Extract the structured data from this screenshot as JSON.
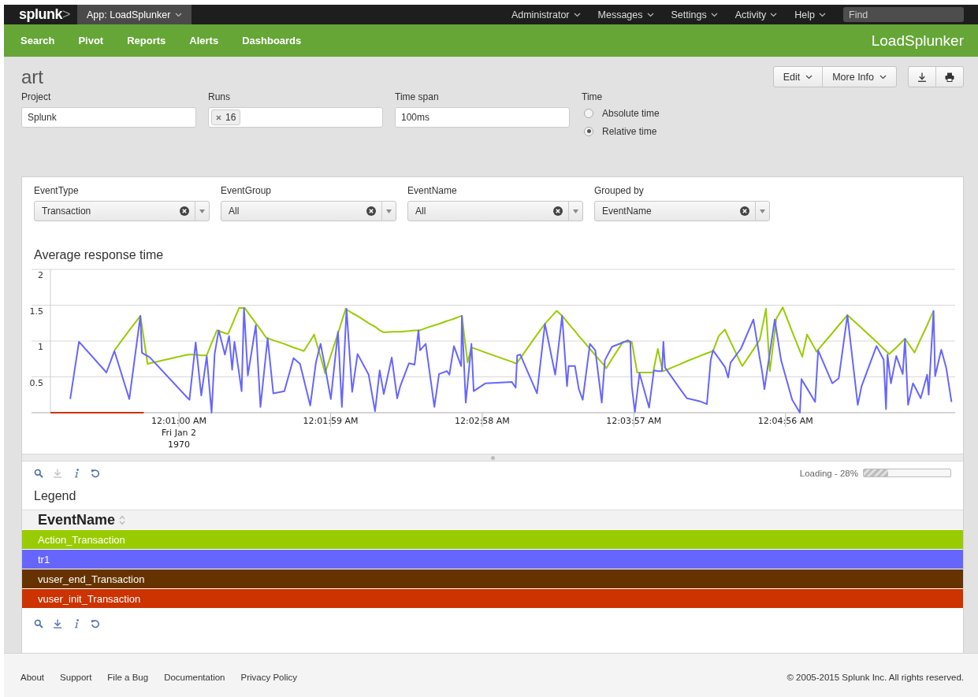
{
  "top_bar": {
    "logo": {
      "word": "splunk",
      "mark": ">"
    },
    "app_menu": "App: LoadSplunker",
    "menus": [
      "Administrator",
      "Messages",
      "Settings",
      "Activity",
      "Help"
    ],
    "search": {
      "placeholder": "Find"
    }
  },
  "nav": {
    "items": [
      "Search",
      "Pivot",
      "Reports",
      "Alerts",
      "Dashboards"
    ],
    "app_name": "LoadSplunker"
  },
  "page": {
    "title": "art",
    "buttons": [
      "Edit",
      "More Info"
    ],
    "icon_buttons": [
      {
        "kind": "download"
      },
      {
        "kind": "print"
      }
    ]
  },
  "inputs": {
    "project": {
      "label": "Project",
      "value": "Splunk"
    },
    "runs": {
      "label": "Runs",
      "tokens": [
        "16"
      ]
    },
    "time_span": {
      "label": "Time span",
      "value": "100ms"
    },
    "time": {
      "label": "Time",
      "options": [
        {
          "label": "Absolute time",
          "selected": false
        },
        {
          "label": "Relative time",
          "selected": true
        }
      ]
    }
  },
  "filters": [
    {
      "label": "EventType",
      "value": "Transaction"
    },
    {
      "label": "EventGroup",
      "value": "All"
    },
    {
      "label": "EventName",
      "value": "All"
    },
    {
      "label": "Grouped by",
      "value": "EventName"
    }
  ],
  "chart_panel": {
    "date_lines": [
      "Fri Jan 2",
      "1970"
    ],
    "chart_data": {
      "type": "line",
      "title": "Average response time",
      "grid": true,
      "xlim": [
        10,
        362
      ],
      "ylim": [
        0,
        2
      ],
      "yticks": [
        0.5,
        1,
        1.5,
        2
      ],
      "xticks": [
        {
          "value": 60,
          "label": "12:01:00 AM"
        },
        {
          "value": 119,
          "label": "12:01:59 AM"
        },
        {
          "value": 178,
          "label": "12:02:58 AM"
        },
        {
          "value": 237,
          "label": "12:03:57 AM"
        },
        {
          "value": 296,
          "label": "12:04:56 AM"
        }
      ],
      "x": [
        10,
        17.7,
        21.1,
        31.8,
        34.9,
        40.7,
        45.0,
        45.6,
        46.3,
        47.8,
        48.7,
        63.5,
        64.1,
        66.5,
        68.7,
        70.8,
        72.7,
        73.9,
        74.8,
        75.5,
        77.9,
        79.1,
        79.5,
        80.7,
        81.6,
        83.4,
        84.4,
        85.3,
        85.6,
        86.8,
        89.9,
        91.7,
        93.9,
        94.5,
        96.7,
        101.0,
        104.6,
        107.1,
        108.6,
        111.1,
        112.6,
        113.3,
        115.1,
        116.9,
        117.2,
        119.1,
        121.9,
        123.4,
        124.9,
        125.2,
        127.4,
        129.5,
        133.8,
        136.3,
        138.1,
        139.7,
        142.8,
        144.9,
        146.1,
        149.5,
        151.7,
        153.2,
        153.8,
        156.0,
        159.4,
        161.2,
        164.3,
        165.2,
        167.0,
        169.8,
        170.1,
        171.6,
        172.3,
        173.8,
        174.7,
        179.3,
        189.5,
        191.0,
        191.3,
        191.6,
        192.8,
        199.3,
        202.4,
        206.4,
        207.0,
        209.1,
        211.0,
        211.6,
        214.1,
        215.6,
        217.1,
        219.9,
        222.0,
        224.5,
        225.7,
        226.3,
        228.5,
        232.8,
        234.6,
        235.6,
        236.2,
        237.4,
        238.3,
        239.2,
        242.9,
        244.5,
        244.8,
        246.3,
        247.9,
        248.2,
        248.5,
        249.1,
        255.2,
        257.7,
        262.6,
        265.4,
        266.9,
        267.8,
        270.0,
        272.4,
        273.7,
        274.6,
        278.6,
        279.2,
        283.5,
        286.0,
        286.9,
        287.8,
        288.4,
        289.9,
        291.8,
        292.4,
        294.3,
        294.9,
        298.6,
        301.6,
        302.2,
        302.5,
        304.4,
        307.5,
        308.1,
        308.7,
        314.2,
        316.7,
        320.1,
        324.1,
        325.6,
        331.4,
        334.2,
        335.1,
        335.7,
        336.4,
        337.0,
        339.1,
        341.6,
        342.5,
        343.7,
        345.6,
        346.2,
        348.6,
        351.1,
        351.7,
        353.6,
        354.2,
        356.6,
        358.5,
        360.6
      ],
      "series": [
        {
          "color": "#99cc00",
          "values": [
            null,
            null,
            null,
            null,
            0.87,
            1.15,
            1.35,
            1.21,
            1.04,
            0.68,
            0.69,
            0.81,
            0.81,
            0.81,
            0.8,
            0.8,
            0.97,
            1.07,
            1.15,
            1.14,
            1.11,
            1.1,
            1.13,
            1.23,
            1.31,
            1.46,
            1.46,
            1.46,
            1.46,
            1.4,
            1.25,
            1.16,
            1.05,
            1.04,
            1.01,
            0.96,
            0.91,
            0.88,
            0.86,
            1.0,
            1.09,
            1.0,
            0.78,
            0.55,
            0.59,
            0.8,
            1.11,
            1.28,
            1.45,
            1.44,
            1.39,
            1.35,
            1.25,
            1.2,
            1.15,
            1.12,
            1.13,
            1.13,
            1.13,
            1.14,
            1.15,
            1.15,
            1.15,
            1.18,
            1.22,
            1.24,
            1.28,
            1.29,
            1.31,
            1.35,
            1.35,
            0.91,
            0.7,
            0.91,
            0.9,
            0.84,
            0.71,
            0.69,
            0.69,
            0.7,
            0.76,
            1.09,
            1.24,
            1.4,
            1.42,
            1.35,
            1.27,
            1.24,
            1.14,
            1.07,
            1.01,
            0.89,
            0.8,
            0.7,
            0.65,
            0.62,
            0.75,
            0.99,
            0.99,
            0.99,
            0.99,
            0.74,
            0.56,
            0.56,
            0.56,
            0.56,
            0.62,
            0.89,
            0.63,
            0.58,
            0.58,
            0.59,
            0.68,
            0.72,
            0.79,
            0.83,
            0.85,
            0.86,
            1.07,
            1.16,
            1.06,
            0.99,
            0.69,
            0.65,
            0.88,
            1.02,
            1.18,
            1.34,
            1.45,
            0.58,
            1.13,
            1.31,
            1.43,
            1.47,
            1.13,
            0.86,
            0.81,
            0.78,
            1.09,
            0.89,
            0.85,
            0.88,
            1.11,
            1.22,
            1.36,
            1.23,
            1.18,
            0.99,
            0.89,
            0.86,
            0.84,
            0.82,
            0.84,
            0.91,
            1.0,
            1.03,
            0.97,
            0.87,
            0.84,
            1.03,
            1.22,
            1.27,
            1.42,
            null,
            null,
            null,
            null
          ]
        },
        {
          "color": "#6666ff",
          "values": [
            null,
            0.19,
            0.99,
            0.56,
            0.86,
            0.19,
            1.35,
            0.84,
            0.82,
            0.79,
            0.77,
            0.2,
            0.18,
            0.98,
            0.24,
            0.79,
            0,
            0.82,
            1.01,
            1.15,
            0.81,
            1.01,
            1.07,
            0.6,
            0.99,
            0.55,
            0.3,
            1.46,
            1.27,
            0.52,
            1.22,
            0.08,
            0.83,
            1.04,
            0.27,
            0.3,
            0.76,
            0.68,
            0.46,
            0.1,
            0.51,
            0.7,
            0.96,
            0.63,
            0.57,
            0.19,
            1.13,
            0.08,
            1.22,
            1.45,
            0.29,
            0.82,
            0.53,
            0.02,
            0.59,
            0.26,
            0.77,
            0.2,
            0.37,
            0.69,
            0.67,
            1.15,
            0.87,
            0.96,
            0.08,
            0.54,
            0.58,
            0.53,
            0.93,
            0.65,
            1.35,
            0.14,
            0.4,
            0.96,
            0.3,
            0.41,
            0.43,
            0.35,
            0.58,
            0.8,
            0.81,
            0.27,
            1.24,
            0.53,
            0.71,
            1.35,
            0.37,
            0.65,
            0.65,
            0.33,
            0.18,
            0.96,
            0.87,
            0.14,
            0.73,
            0.77,
            0.92,
            0.98,
            1.01,
            0.99,
            0.37,
            0.01,
            0.28,
            0.55,
            0.07,
            0.51,
            0.59,
            0.58,
            0.58,
            0.79,
            0.99,
            0.63,
            0.32,
            0.2,
            0.16,
            0.12,
            0.73,
            0.87,
            0.76,
            0.64,
            0.49,
            0.7,
            0.89,
            0.94,
            1.3,
            0.76,
            0.57,
            0.33,
            0.48,
            0.84,
            1.3,
            1.16,
            0.73,
            0.65,
            0.18,
            0,
            0.47,
            0.45,
            0.34,
            0.15,
            0.51,
            0.87,
            0.41,
            0.48,
            1.36,
            0.11,
            0.37,
            0.93,
            0.74,
            0.05,
            0.81,
            0.59,
            0.41,
            0.79,
            0.54,
            1.03,
            0.11,
            0.41,
            0.37,
            0.2,
            0.53,
            0.25,
            1.42,
            0.51,
            0.88,
            0.63,
            0.15
          ]
        },
        {
          "color": "#cc3300",
          "values": [
            0,
            0,
            0,
            0,
            0,
            0,
            0,
            0,
            0,
            null,
            null,
            null,
            null,
            null,
            null,
            null,
            null,
            null,
            null,
            null,
            null,
            null,
            null,
            null,
            null,
            null,
            null,
            null,
            null,
            null,
            null,
            null,
            null,
            null,
            null,
            null,
            null,
            null,
            null,
            null,
            null,
            null,
            null,
            null,
            null,
            null,
            null,
            null,
            null,
            null,
            null,
            null,
            null,
            null,
            null,
            null,
            null,
            null,
            null,
            null,
            null,
            null,
            null,
            null,
            null,
            null,
            null,
            null,
            null,
            null,
            null,
            null,
            null,
            null,
            null,
            null,
            null,
            null,
            null,
            null,
            null,
            null,
            null,
            null,
            null,
            null,
            null,
            null,
            null,
            null,
            null,
            null,
            null,
            null,
            null,
            null,
            null,
            null,
            null,
            null,
            null,
            null,
            null,
            null,
            null,
            null,
            null,
            null,
            null,
            null,
            null,
            null,
            null,
            null,
            null,
            null,
            null,
            null,
            null,
            null,
            null,
            null,
            null,
            null,
            null,
            null,
            null,
            null,
            null,
            null,
            null,
            null,
            null,
            null,
            null,
            null,
            null,
            null,
            null,
            null,
            null,
            null,
            null,
            null,
            null,
            null,
            null,
            null,
            null,
            null,
            null,
            null,
            null,
            null,
            null,
            null,
            null,
            null,
            null,
            null,
            null,
            null,
            null,
            null,
            null,
            null,
            null
          ]
        }
      ]
    },
    "tools": [
      {
        "kind": "search",
        "disabled": false
      },
      {
        "kind": "download",
        "disabled": true
      },
      {
        "kind": "info",
        "disabled": false
      },
      {
        "kind": "refresh",
        "disabled": false
      }
    ],
    "loading": {
      "text": "Loading - 28%",
      "level": 0.28
    }
  },
  "legend": {
    "title": "Legend",
    "column": "EventName",
    "rows": [
      {
        "label": "Action_Transaction",
        "color": "#99cc00"
      },
      {
        "label": "tr1",
        "color": "#6666ff"
      },
      {
        "label": "vuser_end_Transaction",
        "color": "#663300"
      },
      {
        "label": "vuser_init_Transaction",
        "color": "#cc3300"
      }
    ],
    "tools": [
      {
        "kind": "search",
        "disabled": false
      },
      {
        "kind": "download",
        "disabled": false
      },
      {
        "kind": "info",
        "disabled": false
      },
      {
        "kind": "refresh",
        "disabled": false
      }
    ]
  },
  "footer": {
    "links": [
      "About",
      "Support",
      "File a Bug",
      "Documentation",
      "Privacy Policy"
    ],
    "copyright": "© 2005-2015 Splunk Inc. All rights reserved."
  }
}
